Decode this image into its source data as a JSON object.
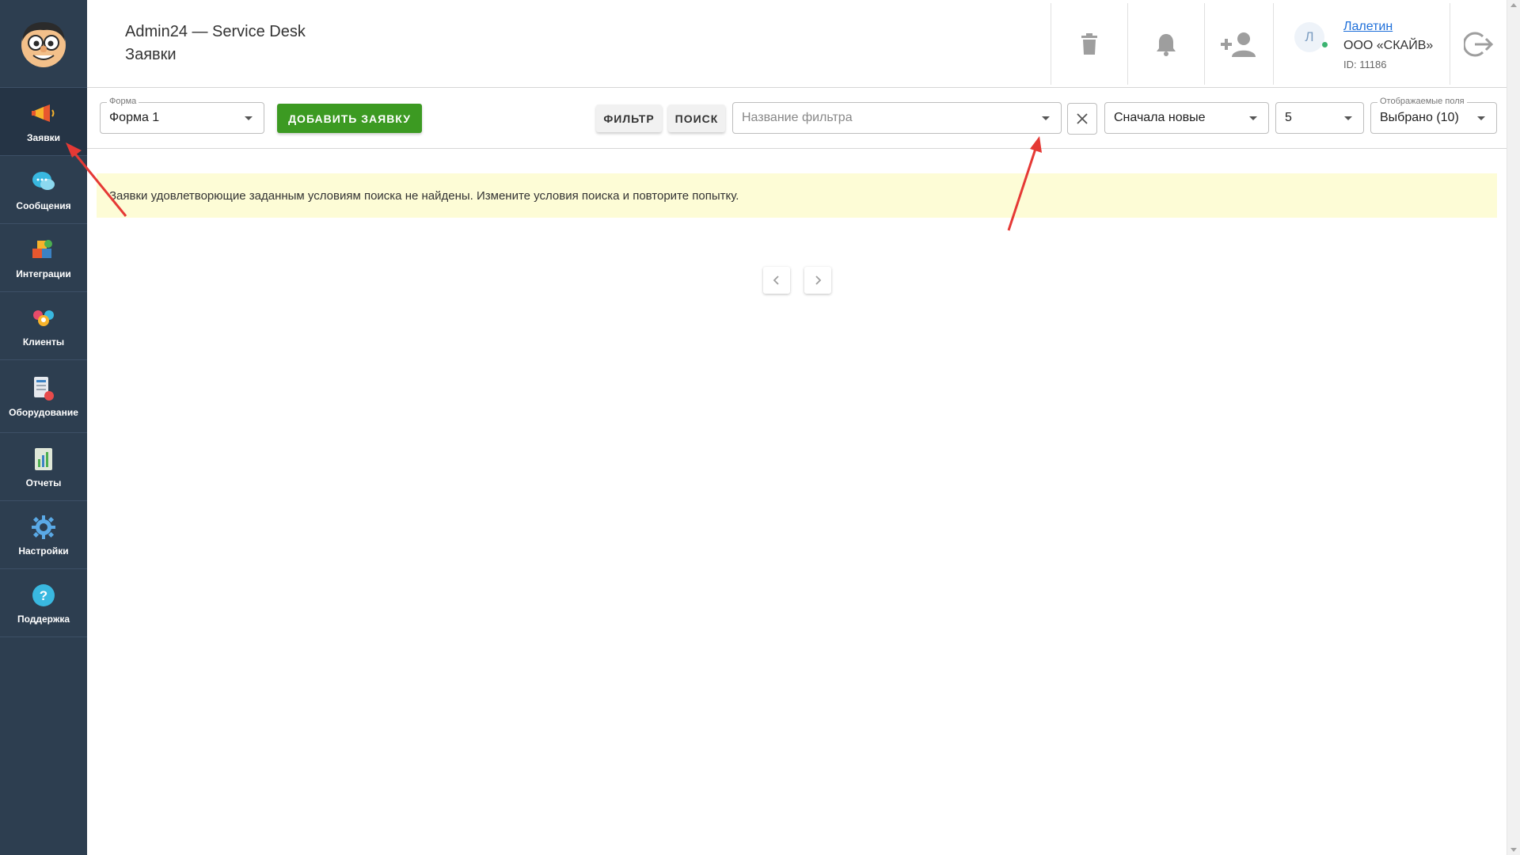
{
  "app": {
    "title": "Admin24 — Service Desk",
    "page_title": "Заявки"
  },
  "sidebar": {
    "items": [
      {
        "label": "Заявки",
        "icon": "megaphone-icon"
      },
      {
        "label": "Сообщения",
        "icon": "chat-bubbles-icon"
      },
      {
        "label": "Интеграции",
        "icon": "puzzle-icon"
      },
      {
        "label": "Клиенты",
        "icon": "clients-icon"
      },
      {
        "label": "Оборудование",
        "icon": "equipment-icon"
      },
      {
        "label": "Отчеты",
        "icon": "report-icon"
      },
      {
        "label": "Настройки",
        "icon": "gear-icon"
      },
      {
        "label": "Поддержка",
        "icon": "help-icon"
      }
    ]
  },
  "header": {
    "user": {
      "avatar_letter": "Л",
      "name": "Лалетин",
      "org": "ООО «СКАЙВ»",
      "id": "ID: 11186"
    }
  },
  "toolbar": {
    "form_legend": "Форма",
    "form_value": "Форма 1",
    "add_button": "ДОБАВИТЬ ЗАЯВКУ",
    "filter_button": "ФИЛЬТР",
    "search_button": "ПОИСК",
    "filter_name_placeholder": "Название фильтра",
    "sort_value": "Сначала новые",
    "per_page_value": "5",
    "fields_legend": "Отображаемые поля",
    "fields_value": "Выбрано (10)"
  },
  "content": {
    "notice": "Заявки удовлетворющие заданным условиям поиска не найдены. Измените условия поиска и повторите попытку."
  },
  "colors": {
    "sidebar_bg": "#2d3e50",
    "add_button_bg": "#3c9a22",
    "notice_bg": "#fdfcd6",
    "annotation_arrow": "#e53935"
  }
}
